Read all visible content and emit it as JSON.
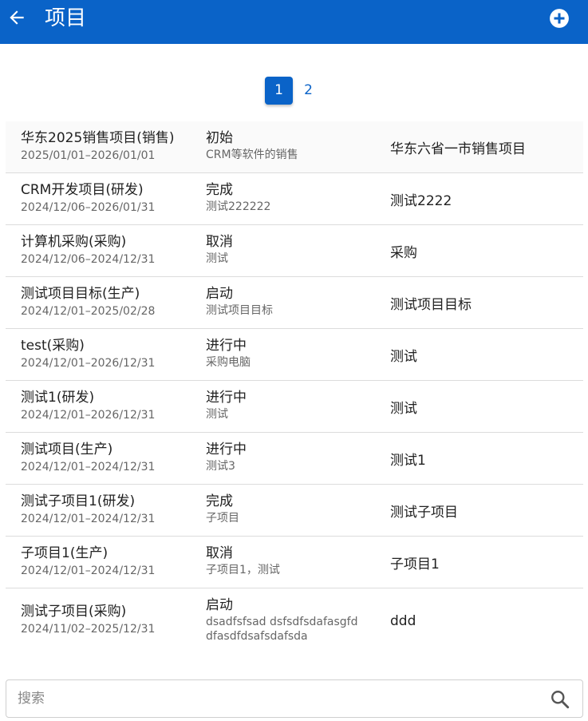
{
  "header": {
    "title": "项目",
    "back_icon": "arrow-left-icon",
    "add_icon": "plus-circle-icon"
  },
  "pagination": {
    "pages": [
      "1",
      "2"
    ],
    "current": "1"
  },
  "projects": [
    {
      "name": "华东2025销售项目(销售)",
      "dates": "2025/01/01–2026/01/01",
      "status": "初始",
      "desc": "CRM等软件的销售",
      "target": "华东六省一市销售项目"
    },
    {
      "name": "CRM开发项目(研发)",
      "dates": "2024/12/06–2026/01/31",
      "status": "完成",
      "desc": "测试222222",
      "target": "测试2222"
    },
    {
      "name": "计算机采购(采购)",
      "dates": "2024/12/06–2024/12/31",
      "status": "取消",
      "desc": "测试",
      "target": "采购"
    },
    {
      "name": "测试项目目标(生产)",
      "dates": "2024/12/01–2025/02/28",
      "status": "启动",
      "desc": "测试项目目标",
      "target": "测试项目目标"
    },
    {
      "name": "test(采购)",
      "dates": "2024/12/01–2026/12/31",
      "status": "进行中",
      "desc": "采购电脑",
      "target": "测试"
    },
    {
      "name": "测试1(研发)",
      "dates": "2024/12/01–2026/12/31",
      "status": "进行中",
      "desc": "测试",
      "target": "测试"
    },
    {
      "name": "测试项目(生产)",
      "dates": "2024/12/01–2024/12/31",
      "status": "进行中",
      "desc": "测试3",
      "target": "测试1"
    },
    {
      "name": "测试子项目1(研发)",
      "dates": "2024/12/01–2024/12/31",
      "status": "完成",
      "desc": "子项目",
      "target": "测试子项目"
    },
    {
      "name": "子项目1(生产)",
      "dates": "2024/12/01–2024/12/31",
      "status": "取消",
      "desc": "子项目1，测试",
      "target": "子项目1"
    },
    {
      "name": "测试子项目(采购)",
      "dates": "2024/11/02–2025/12/31",
      "status": "启动",
      "desc": "dsadfsfsad dsfsdfsdafasgfd dfasdfdsafsdafsda",
      "target": "ddd"
    }
  ],
  "search": {
    "placeholder": "搜索",
    "value": "",
    "icon": "search-icon"
  },
  "colors": {
    "primary": "#0a63c8",
    "divider": "#dcdcdc",
    "secondary_text": "#666666"
  }
}
